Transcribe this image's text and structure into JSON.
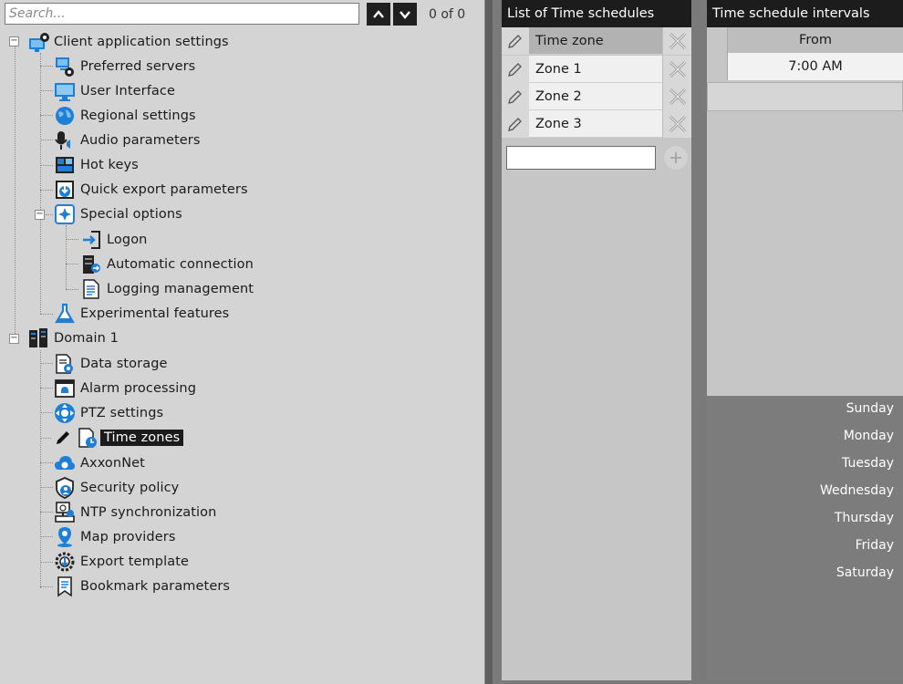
{
  "search": {
    "placeholder": "Search...",
    "value": "",
    "count_text": "0 of 0"
  },
  "tree": {
    "client_settings": "Client application settings",
    "preferred_servers": "Preferred servers",
    "user_interface": "User Interface",
    "regional_settings": "Regional settings",
    "audio_parameters": "Audio parameters",
    "hot_keys": "Hot keys",
    "quick_export": "Quick export parameters",
    "special_options": "Special options",
    "logon": "Logon",
    "automatic_connection": "Automatic connection",
    "logging_management": "Logging management",
    "experimental_features": "Experimental features",
    "domain": "Domain 1",
    "data_storage": "Data storage",
    "alarm_processing": "Alarm processing",
    "ptz_settings": "PTZ settings",
    "time_zones": "Time zones",
    "axxonnet": "AxxonNet",
    "security_policy": "Security policy",
    "ntp_sync": "NTP synchronization",
    "map_providers": "Map providers",
    "export_template": "Export template",
    "bookmark_parameters": "Bookmark parameters",
    "selected": "time_zones"
  },
  "schedules": {
    "title": "List of Time schedules",
    "header_label": "Time zone",
    "zones": [
      "Zone 1",
      "Zone 2",
      "Zone 3"
    ],
    "new_zone_value": ""
  },
  "intervals": {
    "title": "Time schedule intervals",
    "from_label": "From",
    "from_value": "7:00 AM",
    "days": [
      "Sunday",
      "Monday",
      "Tuesday",
      "Wednesday",
      "Thursday",
      "Friday",
      "Saturday"
    ]
  },
  "colors": {
    "title_bar": "#1c1c1c",
    "selection": "#1b1b1b",
    "icon_blue": "#1e7fd6"
  }
}
